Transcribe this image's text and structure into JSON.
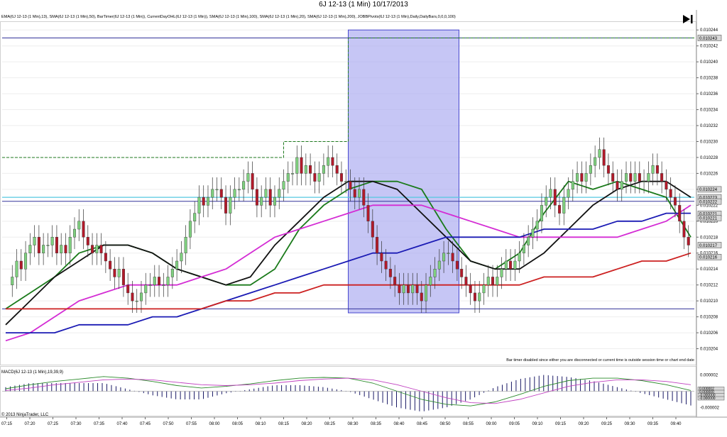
{
  "window": {
    "title": "6J 12-13 (1 Min)  10/17/2013"
  },
  "indicators_label": "EMA(6J 12-13 (1 Min),13), SMA(6J 12-13 (1 Min),50), BarTimer(6J 12-13 (1 Min)), CurrentDayOHL(6J 12-13 (1 Min)), SMA(6J 12-13 (1 Min),100), SMA(6J 12-13 (1 Min),20), SMA(6J 12-13 (1 Min),200), JOBBPivots(6J 12-13 (1 Min),Daily,DailyBars,0,0,0,100)",
  "macd_label": "MACD(6J 12-13 (1 Min),19,39,9)",
  "bar_timer_message": "Bar timer disabled since either you are disconnected or current time is outside session time or chart end date",
  "copyright": "© 2013 NinjaTrader, LLC",
  "price_axis": {
    "ticks": [
      "0.010244",
      "0.010242",
      "0.010240",
      "0.010238",
      "0.010236",
      "0.010234",
      "0.010232",
      "0.010230",
      "0.010228",
      "0.010226",
      "0.010224",
      "0.010222",
      "0.010220",
      "0.010218",
      "0.010216",
      "0.010214",
      "0.010212",
      "0.010210",
      "0.010208",
      "0.010206",
      "0.010204"
    ],
    "markers": [
      {
        "label": "0.010243",
        "value": 0.010243
      },
      {
        "label": "0.010224",
        "value": 0.010224
      },
      {
        "label": "0.010223",
        "value": 0.010223
      },
      {
        "label": "0.010222",
        "value": 0.0102225
      },
      {
        "label": "0.010221",
        "value": 0.010221
      },
      {
        "label": "0.010221",
        "value": 0.0102205
      },
      {
        "label": "0.010217",
        "value": 0.010217
      },
      {
        "label": "0.010216",
        "value": 0.0102155
      }
    ]
  },
  "macd_axis": {
    "ticks": [
      "0.000002",
      "0.000000",
      "-0.000002"
    ],
    "markers": [
      "0.000002",
      "0.000000",
      "-0.000000",
      "-0.000000"
    ]
  },
  "time_axis": [
    "07:15",
    "07:20",
    "07:25",
    "07:30",
    "07:35",
    "07:40",
    "07:45",
    "07:50",
    "07:55",
    "08:00",
    "08:05",
    "08:10",
    "08:15",
    "08:20",
    "08:25",
    "08:30",
    "08:35",
    "08:40",
    "08:45",
    "08:50",
    "08:55",
    "09:00",
    "09:05",
    "09:10",
    "09:15",
    "09:20",
    "09:25",
    "09:30",
    "09:35",
    "09:40"
  ],
  "chart_data": {
    "type": "candlestick",
    "instrument": "6J 12-13 (1 Min)",
    "date": "10/17/2013",
    "ylim": [
      0.010202,
      0.010245
    ],
    "time_range": [
      "07:14",
      "09:44"
    ],
    "current_day_high": 0.010243,
    "current_day_low": 0.010209,
    "pivot_level": 0.0102225,
    "highlight_zone": {
      "start": "08:29",
      "end": "08:53",
      "high": 0.010244,
      "low": 0.0102085
    },
    "day_open_steps": [
      {
        "from": "07:14",
        "to": "08:15",
        "value": 0.010228
      },
      {
        "from": "08:15",
        "to": "08:29",
        "value": 0.01023
      },
      {
        "from": "08:29",
        "to": "08:30",
        "value": 0.010243
      }
    ],
    "closes": [
      0.010212,
      0.010213,
      0.010215,
      0.010214,
      0.010216,
      0.010217,
      0.010218,
      0.010216,
      0.010217,
      0.010217,
      0.010218,
      0.010216,
      0.010217,
      0.010216,
      0.010218,
      0.010219,
      0.01022,
      0.010218,
      0.010217,
      0.010216,
      0.010217,
      0.010216,
      0.010215,
      0.010214,
      0.010213,
      0.010214,
      0.010212,
      0.010211,
      0.01021,
      0.01021,
      0.010211,
      0.010212,
      0.010212,
      0.010213,
      0.010212,
      0.010212,
      0.010213,
      0.010214,
      0.010215,
      0.010216,
      0.010218,
      0.01022,
      0.010221,
      0.010223,
      0.010222,
      0.010223,
      0.010224,
      0.010224,
      0.010223,
      0.010221,
      0.010223,
      0.010224,
      0.010224,
      0.010225,
      0.010226,
      0.010224,
      0.010222,
      0.010223,
      0.010224,
      0.010222,
      0.010223,
      0.010224,
      0.010225,
      0.010226,
      0.010226,
      0.010228,
      0.010226,
      0.010227,
      0.010226,
      0.010225,
      0.010226,
      0.010227,
      0.010228,
      0.010227,
      0.010226,
      0.010225,
      0.010225,
      0.010224,
      0.010223,
      0.010224,
      0.010222,
      0.01022,
      0.010218,
      0.010216,
      0.010215,
      0.010214,
      0.010213,
      0.010212,
      0.010211,
      0.010212,
      0.010211,
      0.010212,
      0.010211,
      0.01021,
      0.010212,
      0.010213,
      0.010214,
      0.010215,
      0.010216,
      0.010216,
      0.010215,
      0.010214,
      0.010213,
      0.010212,
      0.010211,
      0.01021,
      0.010211,
      0.010212,
      0.010213,
      0.010212,
      0.010213,
      0.010214,
      0.010215,
      0.010214,
      0.010215,
      0.010216,
      0.010217,
      0.010218,
      0.010219,
      0.01022,
      0.010222,
      0.010223,
      0.010224,
      0.010222,
      0.010221,
      0.010223,
      0.010224,
      0.010225,
      0.010226,
      0.010225,
      0.010226,
      0.010227,
      0.010228,
      0.010229,
      0.010227,
      0.010226,
      0.010225,
      0.010224,
      0.010225,
      0.010226,
      0.010225,
      0.010226,
      0.010225,
      0.010225,
      0.010226,
      0.010227,
      0.010226,
      0.010225,
      0.010224,
      0.010223,
      0.010222,
      0.01022,
      0.010218,
      0.010217
    ],
    "series": [
      {
        "name": "EMA(13)",
        "color": "#1a7a1a",
        "values": [
          0.010209,
          0.010211,
          0.010213,
          0.010216,
          0.010217,
          0.010217,
          0.010216,
          0.010214,
          0.010213,
          0.010212,
          0.010212,
          0.010214,
          0.010219,
          0.010222,
          0.010224,
          0.010225,
          0.010225,
          0.010224,
          0.010219,
          0.010215,
          0.010214,
          0.010216,
          0.010221,
          0.010225,
          0.010224,
          0.010225,
          0.010224,
          0.010223,
          0.010218
        ]
      },
      {
        "name": "SMA(20)",
        "color": "#111111",
        "values": [
          0.010207,
          0.01021,
          0.010213,
          0.010215,
          0.010217,
          0.010217,
          0.010216,
          0.010214,
          0.010213,
          0.010212,
          0.010213,
          0.010217,
          0.01022,
          0.010223,
          0.010225,
          0.010225,
          0.010224,
          0.010221,
          0.010218,
          0.010215,
          0.010214,
          0.010214,
          0.010216,
          0.010219,
          0.010222,
          0.010224,
          0.010225,
          0.010225,
          0.010223
        ]
      },
      {
        "name": "SMA(50)",
        "color": "#d42cd4",
        "values": [
          0.010205,
          0.010206,
          0.010208,
          0.01021,
          0.010211,
          0.010212,
          0.010212,
          0.010212,
          0.010213,
          0.010214,
          0.010216,
          0.010218,
          0.010219,
          0.01022,
          0.010221,
          0.010222,
          0.010222,
          0.010222,
          0.010221,
          0.01022,
          0.010219,
          0.010218,
          0.010218,
          0.010218,
          0.010218,
          0.010218,
          0.010219,
          0.01022,
          0.010222
        ]
      },
      {
        "name": "SMA(100)",
        "color": "#1a1ab4",
        "values": [
          0.010206,
          0.010206,
          0.010206,
          0.010207,
          0.010207,
          0.010207,
          0.010208,
          0.010208,
          0.010209,
          0.01021,
          0.010211,
          0.010212,
          0.010213,
          0.010214,
          0.010215,
          0.010216,
          0.010216,
          0.010217,
          0.010218,
          0.010218,
          0.010218,
          0.010218,
          0.010219,
          0.010219,
          0.010219,
          0.01022,
          0.01022,
          0.010221,
          0.010221
        ]
      },
      {
        "name": "SMA(200)",
        "color": "#cc2020",
        "values": [
          0.010209,
          0.010209,
          0.010209,
          0.010209,
          0.010209,
          0.010209,
          0.010209,
          0.010209,
          0.010209,
          0.01021,
          0.01021,
          0.010211,
          0.010211,
          0.010212,
          0.010212,
          0.010212,
          0.010212,
          0.010212,
          0.010212,
          0.010212,
          0.010212,
          0.010212,
          0.010213,
          0.010213,
          0.010213,
          0.010214,
          0.010215,
          0.010215,
          0.010216
        ]
      }
    ],
    "macd": {
      "ylim": [
        -3e-06,
        3e-06
      ],
      "macd_values": [
        3e-07,
        8e-07,
        1.2e-06,
        1.5e-06,
        1.8e-06,
        1.6e-06,
        1.2e-06,
        7e-07,
        4e-07,
        6e-07,
        9e-07,
        1.3e-06,
        1.6e-06,
        1.7e-06,
        1.6e-06,
        1e-06,
        0.0,
        -1e-06,
        -1.6e-06,
        -1.8e-06,
        -1.3e-06,
        -4e-07,
        6e-07,
        1.3e-06,
        1.6e-06,
        1.6e-06,
        1.3e-06,
        8e-07,
        1e-07
      ],
      "signal_values": [
        1e-07,
        4e-07,
        8e-07,
        1.1e-06,
        1.4e-06,
        1.5e-06,
        1.4e-06,
        1.1e-06,
        8e-07,
        7e-07,
        8e-07,
        1e-06,
        1.3e-06,
        1.5e-06,
        1.6e-06,
        1.4e-06,
        8e-07,
        0.0,
        -8e-07,
        -1.4e-06,
        -1.5e-06,
        -1e-06,
        -2e-07,
        6e-07,
        1.1e-06,
        1.4e-06,
        1.4e-06,
        1.2e-06,
        8e-07
      ]
    }
  }
}
